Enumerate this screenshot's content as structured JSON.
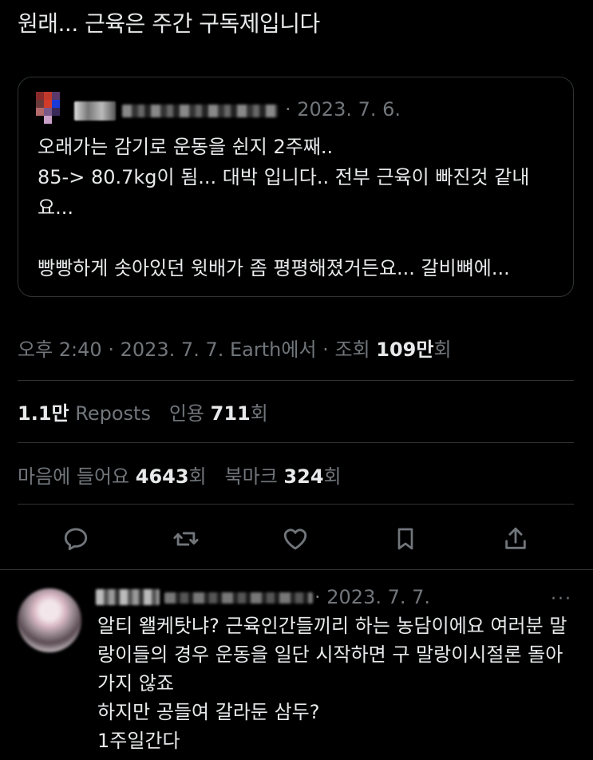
{
  "tweet": {
    "text": "원래... 근육은 주간 구독제입니다",
    "quote": {
      "date": "· 2023. 7. 6.",
      "body": "오래가는 감기로 운동을 쉰지 2주째..\n85-> 80.7kg이 됨... 대박 입니다.. 전부 근육이 빠진것 같내요...\n\n빵빵하게 솟아있던 윗배가 좀 평평해졌거든요... 갈비뼈에..."
    },
    "meta": {
      "time": "오후 2:40",
      "date": "2023. 7. 7.",
      "source": "Earth에서",
      "views_label": "조회",
      "views_value": "109만",
      "views_suffix": "회"
    },
    "stats": {
      "reposts_value": "1.1만",
      "reposts_label": "Reposts",
      "quotes_label": "인용",
      "quotes_value": "711",
      "quotes_suffix": "회",
      "likes_label": "마음에 들어요",
      "likes_value": "4643",
      "likes_suffix": "회",
      "bookmarks_label": "북마크",
      "bookmarks_value": "324",
      "bookmarks_suffix": "회"
    },
    "actions": [
      "reply-icon",
      "repost-icon",
      "like-icon",
      "bookmark-icon",
      "share-icon"
    ]
  },
  "reply": {
    "date": "· 2023. 7. 7.",
    "more": "···",
    "body": "알티 왤케탓냐? 근육인간들끼리 하는 농담이에요 여러분 말랑이들의 경우 운동을 일단 시작하면 구 말랑이시절론 돌아가지 않죠\n하지만 공들여 갈라둔 삼두?\n1주일간다"
  },
  "colors": {
    "background": "#000000",
    "text": "#e7e9ea",
    "muted": "#71767b",
    "border": "#2f3336"
  }
}
